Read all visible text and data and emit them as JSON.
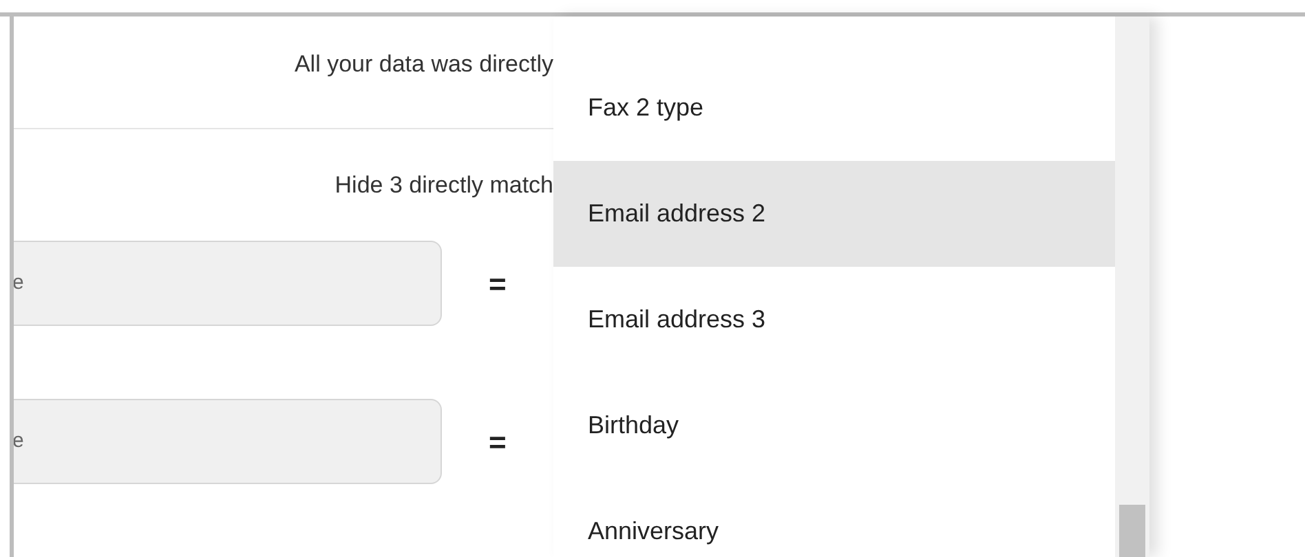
{
  "panel": {
    "message": "All your data was directly",
    "hide_link": "Hide 3 directly match",
    "fields": [
      {
        "value": "e",
        "separator": "="
      },
      {
        "value": "e",
        "separator": "="
      }
    ]
  },
  "dropdown": {
    "items": [
      {
        "label": "Fax 2 type",
        "selected": false
      },
      {
        "label": "Email address 2",
        "selected": true
      },
      {
        "label": "Email address 3",
        "selected": false
      },
      {
        "label": "Birthday",
        "selected": false
      },
      {
        "label": "Anniversary",
        "selected": false
      }
    ]
  }
}
